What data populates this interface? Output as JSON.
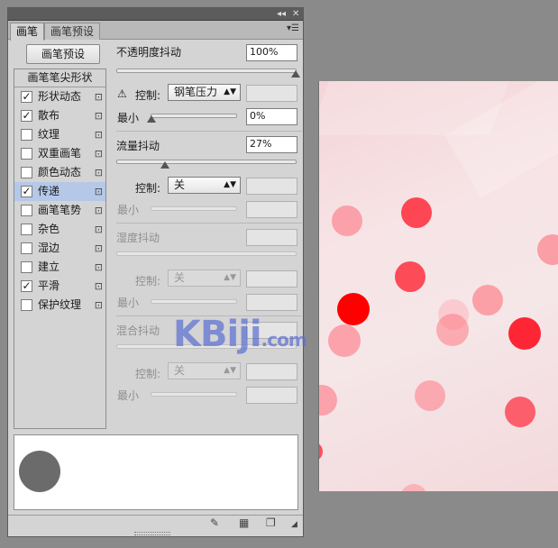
{
  "panel": {
    "window_controls": {
      "collapse": "◂◂",
      "close": "✕"
    },
    "tabs": [
      {
        "label": "画笔"
      },
      {
        "label": "画笔预设"
      }
    ],
    "tab_menu_icon": "panel-menu-icon",
    "preset_button": "画笔预设",
    "list_header": "画笔笔尖形状",
    "items": [
      {
        "label": "形状动态",
        "checked": true,
        "selected": false
      },
      {
        "label": "散布",
        "checked": true,
        "selected": false
      },
      {
        "label": "纹理",
        "checked": false,
        "selected": false
      },
      {
        "label": "双重画笔",
        "checked": false,
        "selected": false
      },
      {
        "label": "颜色动态",
        "checked": false,
        "selected": false
      },
      {
        "label": "传递",
        "checked": true,
        "selected": true
      },
      {
        "label": "画笔笔势",
        "checked": false,
        "selected": false
      },
      {
        "label": "杂色",
        "checked": false,
        "selected": false
      },
      {
        "label": "湿边",
        "checked": false,
        "selected": false
      },
      {
        "label": "建立",
        "checked": false,
        "selected": false
      },
      {
        "label": "平滑",
        "checked": true,
        "selected": false
      },
      {
        "label": "保护纹理",
        "checked": false,
        "selected": false
      }
    ],
    "lock_icon": "lock-icon"
  },
  "settings": {
    "opacity_jitter": {
      "label": "不透明度抖动",
      "value": "100%",
      "level": 1.0
    },
    "opacity_control": {
      "warning_icon": "warning-icon",
      "label": "控制:",
      "value": "钢笔压力"
    },
    "opacity_min": {
      "label": "最小",
      "value": "0%",
      "level": 0.0
    },
    "flow_jitter": {
      "label": "流量抖动",
      "value": "27%",
      "level": 0.27
    },
    "flow_control": {
      "label": "控制:",
      "value": "关"
    },
    "flow_min": {
      "label": "最小"
    },
    "wetness_jitter": {
      "label": "湿度抖动"
    },
    "wetness_control": {
      "label": "控制:",
      "value": "关"
    },
    "wetness_min": {
      "label": "最小"
    },
    "mix_jitter": {
      "label": "混合抖动"
    },
    "mix_control": {
      "label": "控制:",
      "value": "关"
    },
    "mix_min": {
      "label": "最小"
    }
  },
  "bottom_icons": [
    "brush-toggle-icon",
    "grid-icon",
    "new-preset-icon"
  ],
  "watermark": {
    "main": "KBiji",
    "suffix": ".com"
  },
  "colors": {
    "accent": "#b5c8e8",
    "spot_dark": "#ff0000",
    "spot_light": "#f8a0a0"
  }
}
